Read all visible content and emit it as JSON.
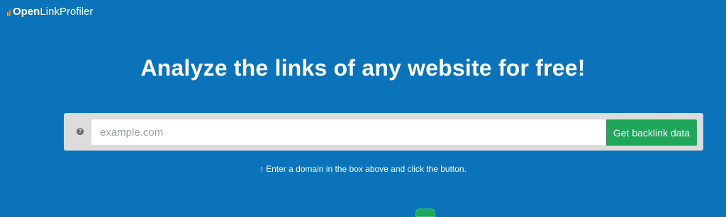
{
  "brand": {
    "name_bold": "Open",
    "name_light": "LinkProfiler",
    "logo_icon": "bar-chart-icon",
    "accent_color": "#e67e22"
  },
  "hero": {
    "headline": "Analyze the links of any website for free!",
    "background_color": "#0a73b9"
  },
  "search": {
    "help_icon": "question-circle-icon",
    "help_glyph": "?",
    "placeholder": "example.com",
    "value": "",
    "button_label": "Get backlink data",
    "button_color": "#1fa65a"
  },
  "hint": {
    "arrow_glyph": "↑",
    "text": "Enter a domain in the box above and click the button."
  }
}
